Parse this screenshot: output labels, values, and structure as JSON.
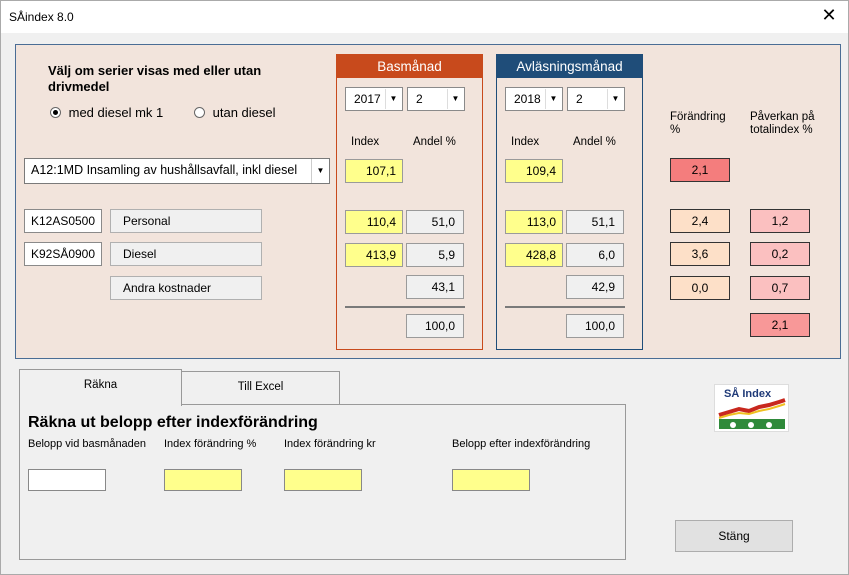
{
  "window": {
    "title": "SÅindex 8.0",
    "close_icon": "close-icon"
  },
  "filter": {
    "question": "Välj om serier visas med eller utan drivmedel",
    "options": [
      {
        "label": "med diesel mk 1",
        "selected": true
      },
      {
        "label": "utan diesel",
        "selected": false
      }
    ]
  },
  "series": {
    "selected": "A12:1MD  Insamling av hushållsavfall, inkl diesel"
  },
  "rows": [
    {
      "code": "K12AS0500",
      "name": "Personal"
    },
    {
      "code": "K92SÅ0900",
      "name": "Diesel"
    },
    {
      "name": "Andra kostnader"
    }
  ],
  "basmanad": {
    "header": "Basmånad",
    "year": "2017",
    "month": "2",
    "col_index": "Index",
    "col_andel": "Andel %",
    "main_index": "107,1",
    "rows": [
      {
        "index": "110,4",
        "andel": "51,0"
      },
      {
        "index": "413,9",
        "andel": "5,9"
      },
      {
        "andel": "43,1"
      }
    ],
    "total": "100,0"
  },
  "avlasningsmanad": {
    "header": "Avläsningsmånad",
    "year": "2018",
    "month": "2",
    "col_index": "Index",
    "col_andel": "Andel %",
    "main_index": "109,4",
    "rows": [
      {
        "index": "113,0",
        "andel": "51,1"
      },
      {
        "index": "428,8",
        "andel": "6,0"
      },
      {
        "andel": "42,9"
      }
    ],
    "total": "100,0"
  },
  "forandring": {
    "label": "Förändring %",
    "main": "2,1",
    "rows": [
      "2,4",
      "3,6",
      "0,0"
    ]
  },
  "paverkan": {
    "label": "Påverkan på totalindex %",
    "rows": [
      "1,2",
      "0,2",
      "0,7"
    ],
    "total": "2,1"
  },
  "tabs": [
    {
      "label": "Räkna",
      "active": true
    },
    {
      "label": "Till Excel",
      "active": false
    }
  ],
  "calc": {
    "title": "Räkna ut belopp efter indexförändring",
    "labels": [
      "Belopp vid basmånaden",
      "Index förändring %",
      "Index förändring kr",
      "Belopp efter indexförändring"
    ],
    "values": [
      "",
      "",
      "",
      ""
    ]
  },
  "logo": {
    "text": "SÅ Index",
    "icon": "sa-index-logo-icon"
  },
  "close_button": "Stäng",
  "colors": {
    "bas": "#c84a1c",
    "avl": "#1f4d79",
    "frame_bg": "#f2e4dc",
    "input_yellow": "#ffff8c"
  }
}
